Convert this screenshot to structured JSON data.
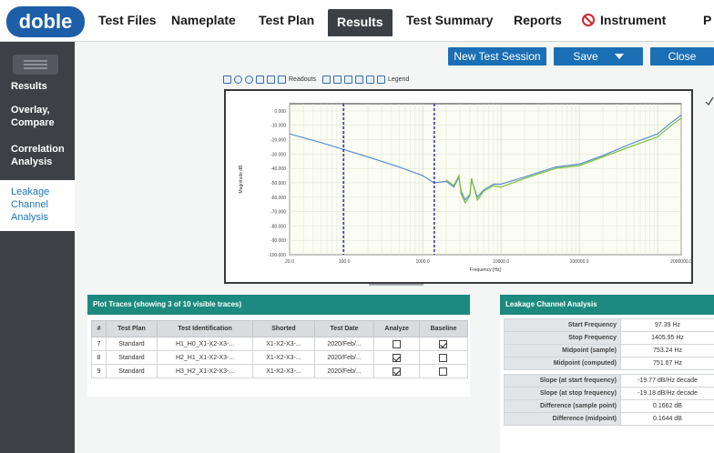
{
  "app": {
    "logo_text": "doble"
  },
  "nav": {
    "tabs": [
      {
        "label": "Test Files"
      },
      {
        "label": "Nameplate"
      },
      {
        "label": "Test Plan"
      },
      {
        "label": "Results"
      },
      {
        "label": "Test Summary"
      },
      {
        "label": "Reports"
      },
      {
        "label": "Instrument"
      },
      {
        "label": "P"
      }
    ]
  },
  "sidebar": {
    "items": [
      {
        "label": "Results"
      },
      {
        "label": "Overlay, Compare"
      },
      {
        "label": "Correlation Analysis"
      },
      {
        "label": "Leakage Channel Analysis"
      }
    ]
  },
  "actions": {
    "new_session": "New Test Session",
    "save": "Save",
    "close": "Close"
  },
  "plot_toolbar": {
    "readouts": "Readouts",
    "legend": "Legend"
  },
  "chart_data": {
    "type": "line",
    "xscale": "log",
    "xlabel": "Frequency [Hz]",
    "ylabel": "Magnitude dB",
    "title": "",
    "x_ticks": [
      "20.0",
      "100.0",
      "1000.0",
      "10000.0",
      "100000.0",
      "2000000.0"
    ],
    "x_tick_values": [
      20,
      100,
      1000,
      10000,
      100000,
      2000000
    ],
    "y_ticks": [
      "0.000",
      "-10.000",
      "-20.000",
      "-30.000",
      "-40.000",
      "-50.000",
      "-60.000",
      "-70.000",
      "-80.000",
      "-90.000",
      "-100.000"
    ],
    "y_tick_values": [
      0,
      -10,
      -20,
      -30,
      -40,
      -50,
      -60,
      -70,
      -80,
      -90,
      -100
    ],
    "xlim": [
      20,
      2000000
    ],
    "ylim": [
      -100,
      5
    ],
    "grid": true,
    "markers": [
      97.39,
      1405.95
    ],
    "series": [
      {
        "color": "#5b8fd0",
        "x": [
          20,
          50,
          100,
          200,
          500,
          1000,
          1400,
          2000,
          2500,
          2900,
          3100,
          3500,
          4000,
          4200,
          5000,
          6000,
          8000,
          10000,
          20000,
          50000,
          100000,
          200000,
          500000,
          1000000,
          1500000,
          2000000
        ],
        "y": [
          -16,
          -22,
          -27,
          -32,
          -39,
          -45,
          -50,
          -49,
          -53,
          -46,
          -56,
          -62,
          -58,
          -48,
          -60,
          -55,
          -51,
          -51,
          -46,
          -39,
          -37,
          -31,
          -22,
          -16,
          -8,
          -3
        ]
      },
      {
        "color": "#7cbf3f",
        "x": [
          2000,
          2500,
          2900,
          3100,
          3500,
          4000,
          4200,
          5000,
          6000,
          8000,
          10000,
          20000,
          50000,
          100000,
          200000,
          500000,
          1000000,
          1500000,
          2000000
        ],
        "y": [
          -48,
          -52,
          -45,
          -58,
          -64,
          -59,
          -47,
          -62,
          -56,
          -52,
          -53,
          -47,
          -40,
          -38,
          -32,
          -24,
          -18,
          -10,
          -5
        ]
      }
    ]
  },
  "plot_traces": {
    "title": "Plot Traces (showing 3 of 10 visible traces)",
    "columns": [
      "#",
      "Test Plan",
      "Test Identification",
      "Shorted",
      "Test Date",
      "Analyze",
      "Baseline"
    ],
    "rows": [
      {
        "num": "7",
        "plan": "Standard",
        "ident": "H1_H0_X1-X2-X3-...",
        "shorted": "X1-X2-X3-...",
        "date": "2020/Feb/...",
        "analyze": false,
        "baseline": true
      },
      {
        "num": "8",
        "plan": "Standard",
        "ident": "H2_H1_X1-X2-X3-...",
        "shorted": "X1-X2-X3-...",
        "date": "2020/Feb/...",
        "analyze": true,
        "baseline": false
      },
      {
        "num": "9",
        "plan": "Standard",
        "ident": "H3_H2_X1-X2-X3-...",
        "shorted": "X1-X2-X3-...",
        "date": "2020/Feb/...",
        "analyze": true,
        "baseline": false
      }
    ]
  },
  "lca": {
    "title": "Leakage Channel Analysis",
    "rows": [
      {
        "key": "Start Frequency",
        "value": "97.39 Hz"
      },
      {
        "key": "Stop Frequency",
        "value": "1405.95 Hz"
      },
      {
        "key": "Midpoint (sample)",
        "value": "753.24 Hz"
      },
      {
        "key": "Midpoint (computed)",
        "value": "751.67 Hz"
      },
      {
        "key": "Slope (at start frequency)",
        "value": "-19.77 dB/Hz decade"
      },
      {
        "key": "Slope (at stop frequency)",
        "value": "-19.18 dB/Hz decade"
      },
      {
        "key": "Difference (sample point)",
        "value": "0.1662 dB"
      },
      {
        "key": "Difference (midpoint)",
        "value": "0.1644 dB"
      }
    ]
  },
  "colors": {
    "accent_blue": "#1b6fb5",
    "teal_header": "#1d8a7f",
    "sidebar_bg": "#3d4045",
    "active_tab_bg": "#3c3f44",
    "marker": "#2222aa"
  }
}
